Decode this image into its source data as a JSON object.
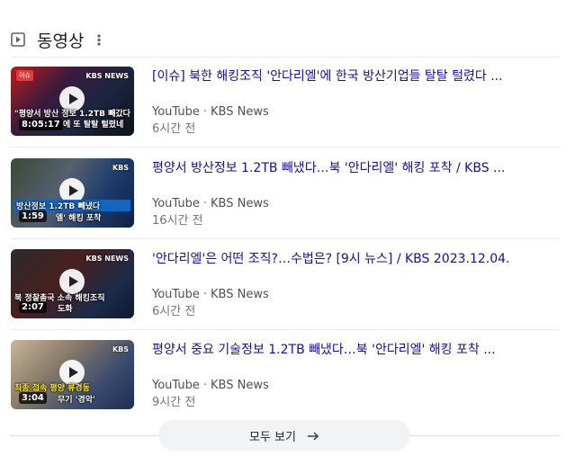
{
  "section": {
    "title": "동영상",
    "icon": "video-play-icon",
    "menu_icon": "more-vert-icon"
  },
  "videos": [
    {
      "title": "[이슈] 북한 해킹조직 '안다리엘'에 한국 방산기업들 탈탈 털렸다 ...",
      "source": "YouTube",
      "channel": "KBS News",
      "ago": "6시간 전",
      "duration": "8:05:17",
      "thumb_caption_top": "\"평양서 방산 정보 1.2TB 빼갔다\"",
      "thumb_caption_bottom": "에 또 탈탈 털렸네",
      "thumb_chip": "이슈",
      "thumb_logo": "KBS NEWS"
    },
    {
      "title": "평양서 방산정보 1.2TB 빼냈다…북 '안다리엘' 해킹 포착 / KBS ...",
      "source": "YouTube",
      "channel": "KBS News",
      "ago": "16시간 전",
      "duration": "1:59",
      "thumb_caption_top": "방산정보 1.2TB 빼냈다",
      "thumb_caption_bottom": "엘' 해킹 포착",
      "thumb_chip": "",
      "thumb_logo": "KBS"
    },
    {
      "title": "'안다리엘'은 어떤 조직?…수법은? [9시 뉴스] / KBS 2023.12.04.",
      "source": "YouTube",
      "channel": "KBS News",
      "ago": "6시간 전",
      "duration": "2:07",
      "thumb_caption_top": "북 정찰총국 소속 해킹조직",
      "thumb_caption_bottom": "도화",
      "thumb_chip": "",
      "thumb_logo": "KBS NEWS"
    },
    {
      "title": "평양서 중요 기술정보 1.2TB 빼냈다…북 '안다리엘' 해킹 포착 ...",
      "source": "YouTube",
      "channel": "KBS News",
      "ago": "9시간 전",
      "duration": "3:04",
      "thumb_caption_top": "최종 접속 평양 류경동",
      "thumb_caption_bottom": "무기 '경악'",
      "thumb_chip": "",
      "thumb_logo": "KBS"
    }
  ],
  "more_button": {
    "label": "모두 보기",
    "icon": "arrow-right-icon"
  },
  "colors": {
    "link": "#1a0dab",
    "meta": "#4d5156",
    "muted": "#70757a",
    "pill_bg": "#f1f3f4"
  }
}
